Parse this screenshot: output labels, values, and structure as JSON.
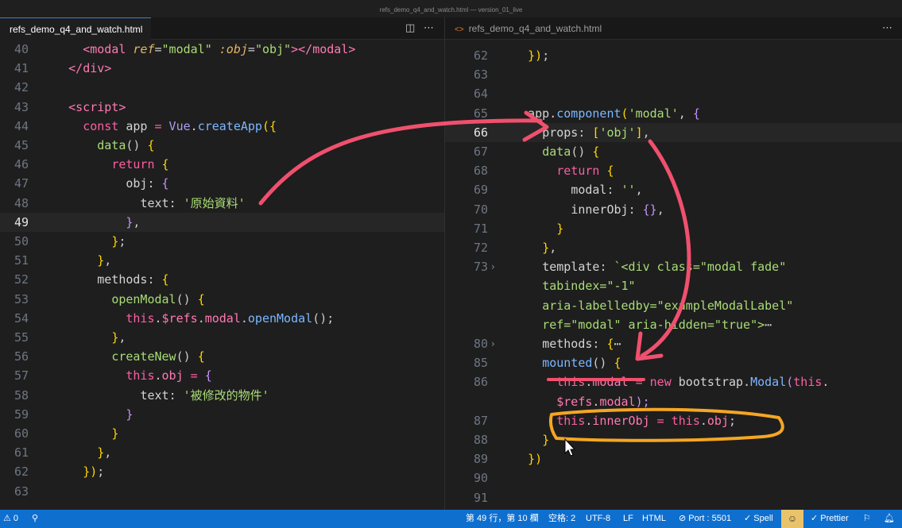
{
  "window_title": "refs_demo_q4_and_watch.html — version_01_live",
  "left_tab": {
    "name": "refs_demo_q4_and_watch.html",
    "split_icon": "split-editor-icon",
    "more_icon": "more-actions-icon"
  },
  "right_tab": {
    "name": "refs_demo_q4_and_watch.html",
    "icon": "html-file-icon",
    "more_icon": "more-actions-icon"
  },
  "left_lines": [
    {
      "n": "40",
      "segs": [
        [
          "      ",
          "p"
        ],
        [
          "<",
          "t"
        ],
        [
          "modal",
          "t"
        ],
        [
          " ",
          "p"
        ],
        [
          "ref",
          "it"
        ],
        [
          "=",
          "p"
        ],
        [
          "\"modal\"",
          "s"
        ],
        [
          " ",
          "p"
        ],
        [
          ":obj",
          "it"
        ],
        [
          "=",
          "p"
        ],
        [
          "\"obj\"",
          "s"
        ],
        [
          "></",
          "t"
        ],
        [
          "modal",
          "t"
        ],
        [
          ">",
          "t"
        ]
      ]
    },
    {
      "n": "41",
      "segs": [
        [
          "    ",
          "p"
        ],
        [
          "</",
          "t"
        ],
        [
          "div",
          "t"
        ],
        [
          ">",
          "t"
        ]
      ]
    },
    {
      "n": "42",
      "segs": []
    },
    {
      "n": "43",
      "segs": [
        [
          "    ",
          "p"
        ],
        [
          "<",
          "t"
        ],
        [
          "script",
          "t"
        ],
        [
          ">",
          "t"
        ]
      ]
    },
    {
      "n": "44",
      "segs": [
        [
          "      ",
          "p"
        ],
        [
          "const",
          "k"
        ],
        [
          " app ",
          "pr"
        ],
        [
          "=",
          "k"
        ],
        [
          " Vue",
          "gr"
        ],
        [
          ".",
          "p"
        ],
        [
          "createApp",
          "f"
        ],
        [
          "({",
          "b"
        ]
      ]
    },
    {
      "n": "45",
      "segs": [
        [
          "        ",
          "p"
        ],
        [
          "data",
          "s"
        ],
        [
          "() ",
          "p"
        ],
        [
          "{",
          "b"
        ]
      ]
    },
    {
      "n": "46",
      "segs": [
        [
          "          ",
          "p"
        ],
        [
          "return",
          "k"
        ],
        [
          " {",
          "b"
        ]
      ]
    },
    {
      "n": "47",
      "segs": [
        [
          "            ",
          "p"
        ],
        [
          "obj",
          "pr"
        ],
        [
          ": ",
          "p"
        ],
        [
          "{",
          "v"
        ]
      ]
    },
    {
      "n": "48",
      "segs": [
        [
          "              ",
          "p"
        ],
        [
          "text",
          "pr"
        ],
        [
          ": ",
          "p"
        ],
        [
          "'原始資料'",
          "s"
        ]
      ]
    },
    {
      "n": "49",
      "segs": [
        [
          "            ",
          "p"
        ],
        [
          "}",
          "v"
        ],
        [
          ",",
          "p"
        ]
      ],
      "cur": true
    },
    {
      "n": "50",
      "segs": [
        [
          "          ",
          "p"
        ],
        [
          "}",
          "b"
        ],
        [
          ";",
          "p"
        ]
      ]
    },
    {
      "n": "51",
      "segs": [
        [
          "        ",
          "p"
        ],
        [
          "}",
          "b"
        ],
        [
          ",",
          "p"
        ]
      ]
    },
    {
      "n": "52",
      "segs": [
        [
          "        ",
          "p"
        ],
        [
          "methods",
          "pr"
        ],
        [
          ": ",
          "p"
        ],
        [
          "{",
          "b"
        ]
      ]
    },
    {
      "n": "53",
      "segs": [
        [
          "          ",
          "p"
        ],
        [
          "openModal",
          "s"
        ],
        [
          "() ",
          "p"
        ],
        [
          "{",
          "b"
        ]
      ]
    },
    {
      "n": "54",
      "segs": [
        [
          "            ",
          "p"
        ],
        [
          "this",
          "k"
        ],
        [
          ".",
          "p"
        ],
        [
          "$refs",
          "t"
        ],
        [
          ".",
          "p"
        ],
        [
          "modal",
          "t"
        ],
        [
          ".",
          "p"
        ],
        [
          "openModal",
          "f"
        ],
        [
          "();",
          "p"
        ]
      ]
    },
    {
      "n": "55",
      "segs": [
        [
          "          ",
          "p"
        ],
        [
          "}",
          "b"
        ],
        [
          ",",
          "p"
        ]
      ]
    },
    {
      "n": "56",
      "segs": [
        [
          "          ",
          "p"
        ],
        [
          "createNew",
          "s"
        ],
        [
          "() ",
          "p"
        ],
        [
          "{",
          "b"
        ]
      ]
    },
    {
      "n": "57",
      "segs": [
        [
          "            ",
          "p"
        ],
        [
          "this",
          "k"
        ],
        [
          ".",
          "p"
        ],
        [
          "obj",
          "t"
        ],
        [
          " = ",
          "k"
        ],
        [
          "{",
          "v"
        ]
      ]
    },
    {
      "n": "58",
      "segs": [
        [
          "              ",
          "p"
        ],
        [
          "text",
          "pr"
        ],
        [
          ": ",
          "p"
        ],
        [
          "'被修改的物件'",
          "s"
        ]
      ]
    },
    {
      "n": "59",
      "segs": [
        [
          "            ",
          "p"
        ],
        [
          "}",
          "v"
        ]
      ]
    },
    {
      "n": "60",
      "segs": [
        [
          "          ",
          "p"
        ],
        [
          "}",
          "b"
        ]
      ]
    },
    {
      "n": "61",
      "segs": [
        [
          "        ",
          "p"
        ],
        [
          "}",
          "b"
        ],
        [
          ",",
          "p"
        ]
      ]
    },
    {
      "n": "62",
      "segs": [
        [
          "      ",
          "p"
        ],
        [
          "})",
          "b"
        ],
        [
          ";",
          "p"
        ]
      ]
    },
    {
      "n": "63",
      "segs": []
    }
  ],
  "right_lines": [
    {
      "n": "62",
      "segs": [
        [
          "    ",
          "p"
        ],
        [
          "})",
          "b"
        ],
        [
          ";",
          "p"
        ]
      ]
    },
    {
      "n": "63",
      "segs": []
    },
    {
      "n": "64",
      "segs": []
    },
    {
      "n": "65",
      "segs": [
        [
          "    ",
          "p"
        ],
        [
          "app",
          "pr"
        ],
        [
          ".",
          "p"
        ],
        [
          "component",
          "f"
        ],
        [
          "(",
          "b"
        ],
        [
          "'modal'",
          "s"
        ],
        [
          ", ",
          "p"
        ],
        [
          "{",
          "v"
        ]
      ]
    },
    {
      "n": "66",
      "segs": [
        [
          "      ",
          "p"
        ],
        [
          "props",
          "pr"
        ],
        [
          ": ",
          "p"
        ],
        [
          "[",
          "b"
        ],
        [
          "'obj'",
          "s"
        ],
        [
          "]",
          "b"
        ],
        [
          ",",
          "p"
        ]
      ],
      "cur": true
    },
    {
      "n": "67",
      "segs": [
        [
          "      ",
          "p"
        ],
        [
          "data",
          "s"
        ],
        [
          "() ",
          "p"
        ],
        [
          "{",
          "b"
        ]
      ]
    },
    {
      "n": "68",
      "segs": [
        [
          "        ",
          "p"
        ],
        [
          "return",
          "k"
        ],
        [
          " {",
          "b"
        ]
      ]
    },
    {
      "n": "69",
      "segs": [
        [
          "          ",
          "p"
        ],
        [
          "modal",
          "pr"
        ],
        [
          ": ",
          "p"
        ],
        [
          "''",
          "s"
        ],
        [
          ",",
          "p"
        ]
      ]
    },
    {
      "n": "70",
      "segs": [
        [
          "          ",
          "p"
        ],
        [
          "innerObj",
          "pr"
        ],
        [
          ": ",
          "p"
        ],
        [
          "{}",
          "v"
        ],
        [
          ",",
          "p"
        ]
      ]
    },
    {
      "n": "71",
      "segs": [
        [
          "        ",
          "p"
        ],
        [
          "}",
          "b"
        ]
      ]
    },
    {
      "n": "72",
      "segs": [
        [
          "      ",
          "p"
        ],
        [
          "}",
          "b"
        ],
        [
          ",",
          "p"
        ]
      ]
    },
    {
      "n": "73",
      "segs": [
        [
          "      ",
          "p"
        ],
        [
          "template",
          "pr"
        ],
        [
          ": ",
          "p"
        ],
        [
          "`<div class=\"modal fade\"",
          "s"
        ]
      ],
      "fold": true
    },
    {
      "n": "",
      "segs": [
        [
          "      ",
          "p"
        ],
        [
          "tabindex=\"-1\"",
          "s"
        ]
      ]
    },
    {
      "n": "",
      "segs": [
        [
          "      ",
          "p"
        ],
        [
          "aria-labelledby=\"exampleModalLabel\"",
          "s"
        ]
      ]
    },
    {
      "n": "",
      "segs": [
        [
          "      ",
          "p"
        ],
        [
          "ref=\"modal\" aria-hidden=\"true\">",
          "s"
        ],
        [
          "⋯",
          "p"
        ]
      ]
    },
    {
      "n": "80",
      "segs": [
        [
          "      ",
          "p"
        ],
        [
          "methods",
          "pr"
        ],
        [
          ": ",
          "p"
        ],
        [
          "{",
          "b"
        ],
        [
          "⋯",
          "p"
        ]
      ],
      "fold": true
    },
    {
      "n": "85",
      "segs": [
        [
          "      ",
          "p"
        ],
        [
          "mounted",
          "f"
        ],
        [
          "() ",
          "p"
        ],
        [
          "{",
          "b"
        ]
      ]
    },
    {
      "n": "86",
      "segs": [
        [
          "        ",
          "p"
        ],
        [
          "this",
          "k"
        ],
        [
          ".",
          "p"
        ],
        [
          "modal",
          "t"
        ],
        [
          " = ",
          "k"
        ],
        [
          "new",
          "k"
        ],
        [
          " bootstrap",
          "pr"
        ],
        [
          ".",
          "p"
        ],
        [
          "Modal",
          "f"
        ],
        [
          "(",
          "v"
        ],
        [
          "this",
          "k"
        ],
        [
          ".",
          "p"
        ]
      ]
    },
    {
      "n": "",
      "segs": [
        [
          "        ",
          "p"
        ],
        [
          "$refs",
          "t"
        ],
        [
          ".",
          "p"
        ],
        [
          "modal",
          "t"
        ],
        [
          ");",
          "v"
        ]
      ]
    },
    {
      "n": "87",
      "segs": [
        [
          "        ",
          "p"
        ],
        [
          "this",
          "k"
        ],
        [
          ".",
          "p"
        ],
        [
          "innerObj",
          "t"
        ],
        [
          " = ",
          "k"
        ],
        [
          "this",
          "k"
        ],
        [
          ".",
          "p"
        ],
        [
          "obj",
          "t"
        ],
        [
          ";",
          "p"
        ]
      ]
    },
    {
      "n": "88",
      "segs": [
        [
          "      ",
          "p"
        ],
        [
          "}",
          "b"
        ]
      ]
    },
    {
      "n": "89",
      "segs": [
        [
          "    ",
          "p"
        ],
        [
          "})",
          "b"
        ]
      ]
    },
    {
      "n": "90",
      "segs": []
    },
    {
      "n": "91",
      "segs": []
    }
  ],
  "status": {
    "problems": "⚠ 0",
    "branch_icon": "⚲",
    "position": "第 49 行，第 10 欄",
    "spaces": "空格: 2",
    "encoding": "UTF-8",
    "eol": "LF",
    "language": "HTML",
    "port": "⊘ Port : 5501",
    "spell": "✓ Spell",
    "prettier": "✓ Prettier"
  }
}
